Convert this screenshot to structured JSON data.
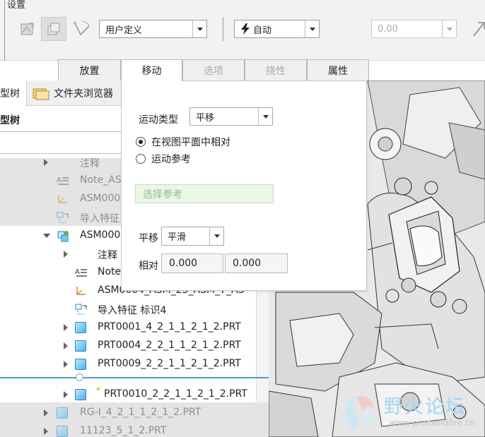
{
  "ribbon": {
    "title": "设置",
    "motion_mode_select": "用户定义",
    "snap_select": "自动",
    "value_field": "0.00"
  },
  "tabs": [
    {
      "label": "放置",
      "state": "normal"
    },
    {
      "label": "移动",
      "state": "active"
    },
    {
      "label": "选项",
      "state": "disabled"
    },
    {
      "label": "挠性",
      "state": "disabled"
    },
    {
      "label": "属性",
      "state": "normal"
    }
  ],
  "left_tabs": {
    "model_tree": "型树",
    "folder_browser": "文件夹浏览器"
  },
  "tree_header": "型树",
  "tree": [
    {
      "label": "注释",
      "expander": "closed",
      "icon": "none",
      "dim": true
    },
    {
      "label": "Note_AS",
      "expander": "none",
      "icon": "note-icon",
      "dim": true
    },
    {
      "label": "ASM000",
      "expander": "none",
      "icon": "csys-icon",
      "dim": true
    },
    {
      "label": "导入特征",
      "expander": "none",
      "icon": "import-feature-icon",
      "dim": true
    },
    {
      "label": "ASM000",
      "expander": "open",
      "icon": "assembly-icon",
      "dim": false
    },
    {
      "label": "注释",
      "expander": "closed",
      "icon": "none",
      "dim": false
    },
    {
      "label": "Note",
      "expander": "none",
      "icon": "note-icon",
      "dim": false
    },
    {
      "label": "ASM0004_ASM_25_ASM_7_AS",
      "expander": "none",
      "icon": "csys-icon",
      "dim": false
    },
    {
      "label": "导入特征 标识4",
      "expander": "none",
      "icon": "import-feature-icon",
      "dim": false
    },
    {
      "label": "PRT0001_4_2_1_1_2_1_2.PRT",
      "expander": "closed",
      "icon": "part-icon",
      "dim": false
    },
    {
      "label": "PRT0004_2_2_1_1_2_1_2.PRT",
      "expander": "closed",
      "icon": "part-icon",
      "dim": false
    },
    {
      "label": "PRT0009_2_2_1_1_2_1_2.PRT",
      "expander": "closed",
      "icon": "part-icon",
      "dim": false
    },
    {
      "label": "PRT0010_2_2_1_1_2_1_2.PRT",
      "expander": "closed",
      "icon": "part-icon",
      "dim": false,
      "marker": "*"
    },
    {
      "label": "RG-I_4_2_1_1_2_1_2.PRT",
      "expander": "closed",
      "icon": "part-icon",
      "dim": true
    },
    {
      "label": "11123_5_1_2.PRT",
      "expander": "closed",
      "icon": "part-icon",
      "dim": true
    }
  ],
  "move_panel": {
    "motion_type_label": "运动类型",
    "motion_type_value": "平移",
    "radio_view_plane": "在视图平面中相对",
    "radio_motion_ref": "运动参考",
    "reference_placeholder": "选择参考",
    "translate_label": "平移",
    "translate_value": "平滑",
    "relative_label": "相对",
    "relative_x": "0.000",
    "relative_y": "0.000"
  },
  "watermark": {
    "name": "野火论坛",
    "url": "www.proewildfire.cn"
  },
  "colors": {
    "accent_blue": "#2a86c0",
    "ref_field_bg": "#eaf7e4",
    "watermark": "#9fd6f2"
  }
}
